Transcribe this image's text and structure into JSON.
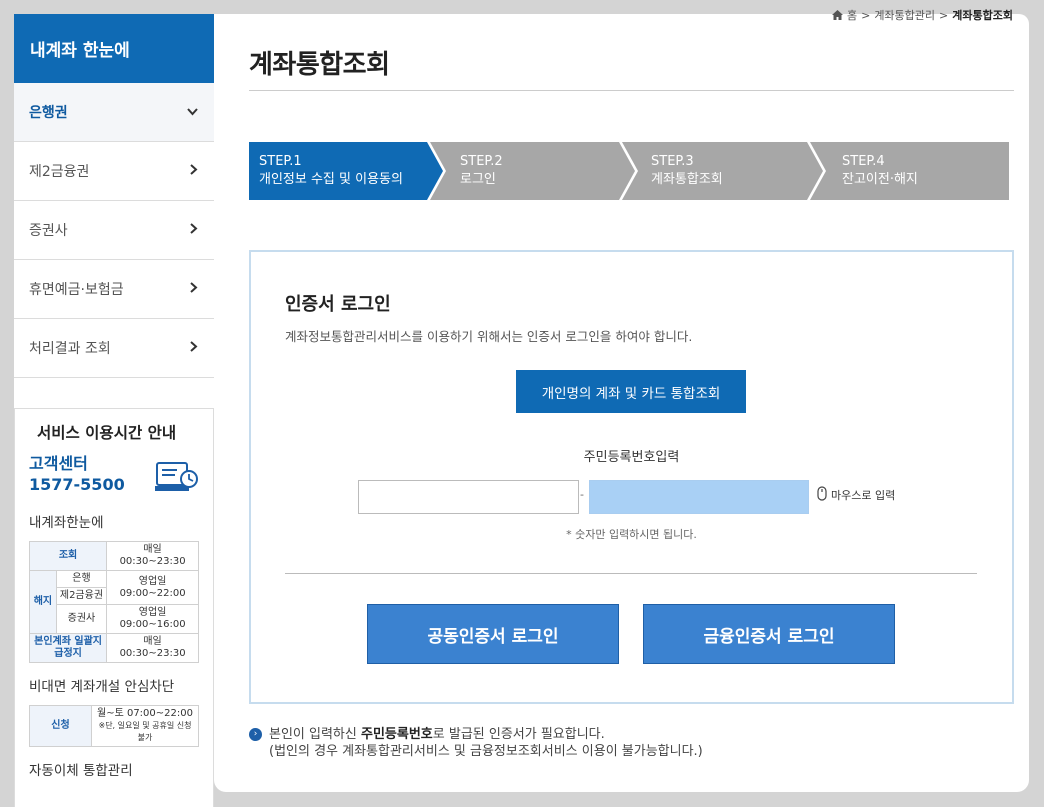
{
  "sidebar": {
    "header": "내계좌 한눈에",
    "items": [
      {
        "label": "은행권",
        "active": true,
        "icon": "chevron-down-icon"
      },
      {
        "label": "제2금융권",
        "active": false,
        "icon": "chevron-right-icon"
      },
      {
        "label": "증권사",
        "active": false,
        "icon": "chevron-right-icon"
      },
      {
        "label": "휴면예금·보험금",
        "active": false,
        "icon": "chevron-right-icon"
      },
      {
        "label": "처리결과 조회",
        "active": false,
        "icon": "chevron-right-icon"
      }
    ],
    "service": {
      "title": "서비스 이용시간 안내",
      "cc_label": "고객센터",
      "cc_number": "1577-5500",
      "section1": "내계좌한눈에",
      "table1": {
        "inquiry": "조회",
        "inquiry_time": "매일 00:30~23:30",
        "cancel": "해지",
        "bank": "은행",
        "second": "제2금융권",
        "bank_time": "영업일 09:00~22:00",
        "securities": "증권사",
        "securities_time": "영업일 09:00~16:00",
        "stop": "본인계좌 일괄지급정지",
        "stop_time": "매일 00:30~23:30"
      },
      "section2": "비대면 계좌개설 안심차단",
      "table2": {
        "apply": "신청",
        "apply_time": "월~토 07:00~22:00",
        "apply_note": "※단, 일요일 및 공휴일 신청 불가"
      },
      "section3": "자동이체 통합관리"
    }
  },
  "breadcrumb": {
    "home": "홈",
    "level1": "계좌통합관리",
    "current": "계좌통합조회"
  },
  "page_title": "계좌통합조회",
  "steps": [
    {
      "step": "STEP.1",
      "label": "개인정보 수집 및 이용동의",
      "active": true
    },
    {
      "step": "STEP.2",
      "label": "로그인",
      "active": false
    },
    {
      "step": "STEP.3",
      "label": "계좌통합조회",
      "active": false
    },
    {
      "step": "STEP.4",
      "label": "잔고이전·해지",
      "active": false
    }
  ],
  "login": {
    "title": "인증서 로그인",
    "description": "계좌정보통합관리서비스를 이용하기 위해서는 인증서 로그인을 하여야 합니다.",
    "personal_button": "개인명의 계좌 및 카드 통합조회",
    "rrn_label": "주민등록번호입력",
    "rrn_front_value": "",
    "rrn_back_value": "",
    "separator": "-",
    "mouse_input": "마우스로 입력",
    "note": "* 숫자만 입력하시면 됩니다.",
    "joint_cert_button": "공동인증서 로그인",
    "financial_cert_button": "금융인증서 로그인"
  },
  "info": {
    "line1_pre": "본인이 입력하신 ",
    "line1_bold": "주민등록번호",
    "line1_post": "로 발급된 인증서가 필요합니다.",
    "line2": "(법인의 경우 계좌통합관리서비스 및 금융정보조회서비스 이용이 불가능합니다.)"
  },
  "colors": {
    "primary": "#0f6ab4",
    "step_inactive": "#a7a7a7",
    "cert_button": "#3b82d0",
    "rrn_back_fill": "#a9d0f5"
  }
}
